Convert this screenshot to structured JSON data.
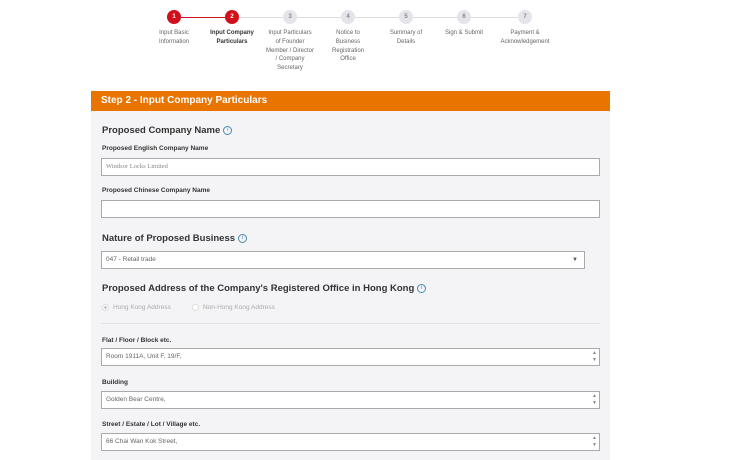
{
  "stepper": {
    "steps": [
      {
        "number": "1",
        "label": "Input Basic Information",
        "state": "done"
      },
      {
        "number": "2",
        "label": "Input Company Particulars",
        "state": "current"
      },
      {
        "number": "3",
        "label": "Input Particulars of Founder Member / Director / Company Secretary",
        "state": "pending"
      },
      {
        "number": "4",
        "label": "Notice to Business Registration Office",
        "state": "pending"
      },
      {
        "number": "5",
        "label": "Summary of Details",
        "state": "pending"
      },
      {
        "number": "6",
        "label": "Sign & Submit",
        "state": "pending"
      },
      {
        "number": "7",
        "label": "Payment & Acknowledgement",
        "state": "pending"
      }
    ]
  },
  "form": {
    "header": "Step 2 - Input Company Particulars",
    "company_name": {
      "title": "Proposed Company Name",
      "english_label": "Proposed English Company Name",
      "english_value": "Windsor Locks Limited",
      "chinese_label": "Proposed Chinese Company Name",
      "chinese_value": ""
    },
    "business": {
      "title": "Nature of Proposed Business",
      "selected": "047 - Retail trade"
    },
    "address": {
      "title": "Proposed Address of the Company's Registered Office in Hong Kong",
      "radio_hk": "Hong Kong Address",
      "radio_non_hk": "Non-Hong Kong Address",
      "selected": "Hong Kong Address",
      "flat_label": "Flat / Floor / Block etc.",
      "flat_value": "Room 1911A, Unit F, 19/F,",
      "building_label": "Building",
      "building_value": "Golden Bear Centre,",
      "street_label": "Street / Estate / Lot / Village etc.",
      "street_value": "66 Chai Wan Kok Street,"
    }
  },
  "colors": {
    "accent": "#e97400",
    "step_active": "#d0111b",
    "panel": "#f4f4f6"
  }
}
